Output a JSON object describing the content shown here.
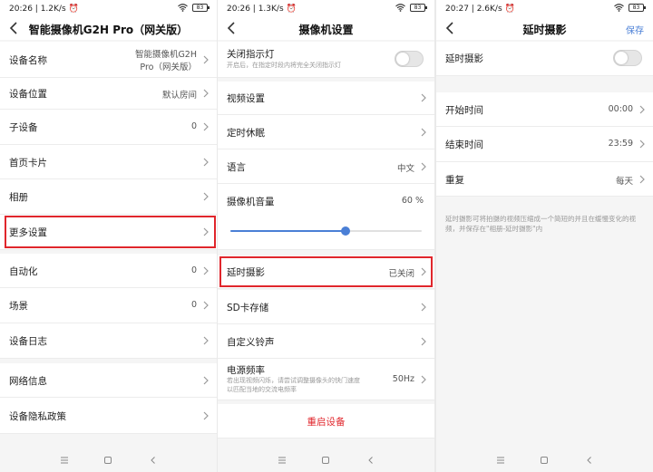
{
  "panel1": {
    "status": {
      "time": "20:26",
      "speed": "1.2K/s",
      "battery": "83"
    },
    "title": "智能摄像机G2H Pro（网关版）",
    "rows": [
      {
        "label": "设备名称",
        "value": "智能摄像机G2H",
        "value2": "Pro（网关版）"
      },
      {
        "label": "设备位置",
        "value": "默认房间"
      },
      {
        "label": "子设备",
        "value": "0"
      },
      {
        "label": "首页卡片",
        "value": ""
      },
      {
        "label": "相册",
        "value": ""
      },
      {
        "label": "更多设置",
        "value": ""
      },
      {
        "label": "自动化",
        "value": "0"
      },
      {
        "label": "场景",
        "value": "0"
      },
      {
        "label": "设备日志",
        "value": ""
      },
      {
        "label": "网络信息",
        "value": ""
      },
      {
        "label": "设备隐私政策",
        "value": ""
      }
    ]
  },
  "panel2": {
    "status": {
      "time": "20:26",
      "speed": "1.3K/s",
      "battery": "83"
    },
    "title": "摄像机设置",
    "indicator": {
      "label": "关闭指示灯",
      "sub": "开启后，在指定时段内将完全关闭指示灯"
    },
    "rows": [
      {
        "label": "视频设置",
        "value": ""
      },
      {
        "label": "定时休眠",
        "value": ""
      },
      {
        "label": "语言",
        "value": "中文"
      }
    ],
    "volume": {
      "label": "摄像机音量",
      "value": "60 %",
      "level": 0.6
    },
    "rows2": [
      {
        "label": "延时摄影",
        "value": "已关闭"
      },
      {
        "label": "SD卡存储",
        "value": ""
      },
      {
        "label": "自定义铃声",
        "value": ""
      }
    ],
    "power": {
      "label": "电源频率",
      "value": "50Hz",
      "sub1": "若出现视频闪烁，请尝试调整摄像头的快门速度",
      "sub2": "以匹配当地的交流电频率"
    },
    "restart": "重启设备"
  },
  "panel3": {
    "status": {
      "time": "20:27",
      "speed": "2.6K/s",
      "battery": "83"
    },
    "title": "延时摄影",
    "save": "保存",
    "toggle_label": "延时摄影",
    "rows": [
      {
        "label": "开始时间",
        "value": "00:00"
      },
      {
        "label": "结束时间",
        "value": "23:59"
      },
      {
        "label": "重复",
        "value": "每天"
      }
    ],
    "note": "延时摄影可将拍摄的视频压缩成一个简短的并且在缓慢变化的视频，并保存在\"相册-延时摄影\"内"
  },
  "icons": {
    "back": "back-arrow-icon",
    "chevron": "chevron-right-icon",
    "wifi": "wifi-icon",
    "alarm": "alarm-icon",
    "menu": "menu-icon",
    "home": "home-icon",
    "nav_back": "nav-back-icon"
  },
  "colors": {
    "accent": "#4a7fd6",
    "highlight": "#e0262c",
    "danger": "#e0262c"
  }
}
